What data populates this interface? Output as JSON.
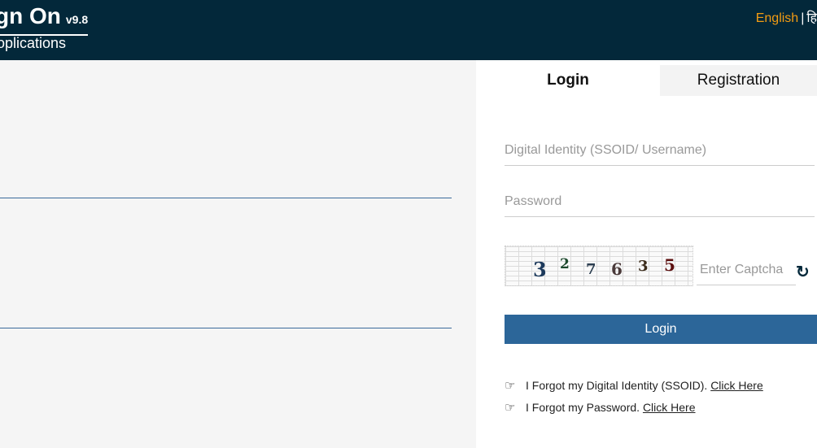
{
  "header": {
    "title": "gn On",
    "version": "v9.8",
    "subtitle": "oplications",
    "lang_english": "English",
    "lang_separator": "|",
    "lang_hindi": "हि"
  },
  "tabs": {
    "login": "Login",
    "registration": "Registration"
  },
  "form": {
    "username_placeholder": "Digital Identity (SSOID/ Username)",
    "password_placeholder": "Password",
    "captcha_placeholder": "Enter Captcha",
    "captcha_digits": [
      "3",
      "2",
      "7",
      "6",
      "3",
      "5"
    ],
    "login_button": "Login"
  },
  "help": {
    "forgot_ssoid_text": "I Forgot my Digital Identity (SSOID).",
    "forgot_ssoid_link": "Click Here",
    "forgot_password_text": "I Forgot my Password.",
    "forgot_password_link": "Click Here"
  },
  "colors": {
    "header_bg": "#03283a",
    "accent_orange": "#f39c12",
    "button_blue": "#2c6699"
  }
}
